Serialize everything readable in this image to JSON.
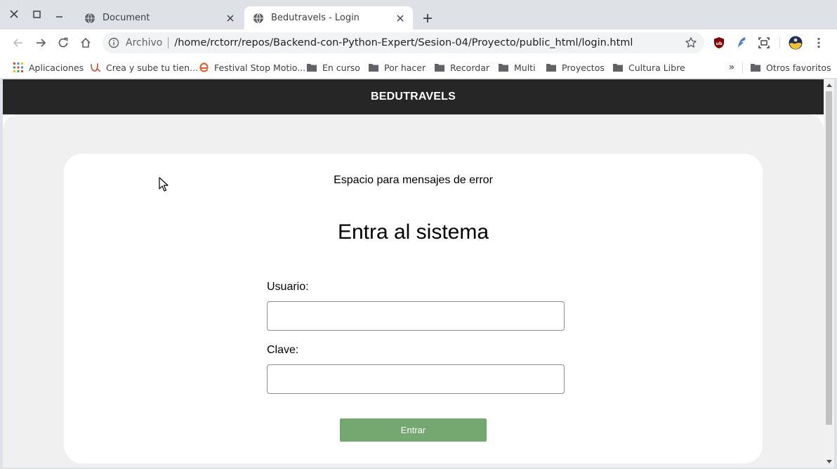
{
  "browser": {
    "tabs": [
      {
        "title": "Document"
      },
      {
        "title": "Bedutravels - Login"
      }
    ],
    "omnibox": {
      "scheme_label": "Archivo",
      "url": "/home/rctorr/repos/Backend-con-Python-Expert/Sesion-04/Proyecto/public_html/login.html"
    },
    "bookmarks": [
      {
        "label": "Aplicaciones",
        "icon": "apps-grid-icon"
      },
      {
        "label": "Crea y sube tu tien...",
        "icon": "udemy-icon"
      },
      {
        "label": "Festival Stop Motio...",
        "icon": "e-logo-icon"
      },
      {
        "label": "En curso",
        "icon": "folder-icon"
      },
      {
        "label": "Por hacer",
        "icon": "folder-icon"
      },
      {
        "label": "Recordar",
        "icon": "folder-icon"
      },
      {
        "label": "Multi",
        "icon": "folder-icon"
      },
      {
        "label": "Proyectos",
        "icon": "folder-icon"
      },
      {
        "label": "Cultura Libre",
        "icon": "folder-icon"
      }
    ],
    "bookmarks_more": "»",
    "other_bookmarks": "Otros favoritos"
  },
  "site": {
    "brand": "BEDUTRAVELS",
    "error_message": "Espacio para mensajes de error",
    "heading": "Entra al sistema",
    "username_label": "Usuario:",
    "username_value": "",
    "password_label": "Clave:",
    "password_value": "",
    "submit_label": "Entrar"
  },
  "colors": {
    "header_bg": "#262626",
    "page_bg": "#f0f0f0",
    "button_bg": "#74a870",
    "tab_strip": "#dee1e6"
  }
}
